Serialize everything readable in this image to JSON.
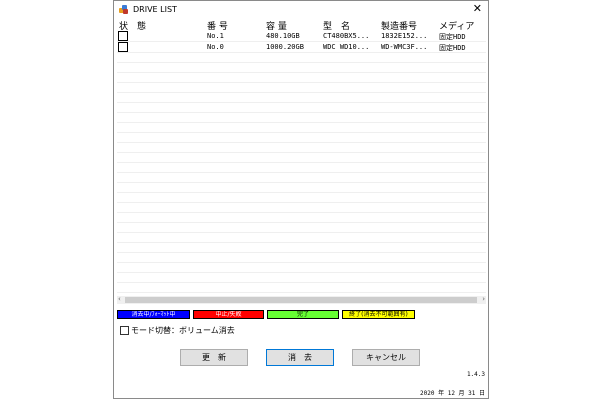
{
  "window": {
    "title": "DRIVE LIST",
    "close_glyph": "✕"
  },
  "columns": [
    "状　態",
    "番 号",
    "容 量",
    "型　名",
    "製造番号",
    "メディア"
  ],
  "rows": [
    {
      "checked": false,
      "number": "No.1",
      "capacity": "480.10GB",
      "model": "CT480BX5...",
      "serial": "1832E152...",
      "media": "固定HDD"
    },
    {
      "checked": false,
      "number": "No.0",
      "capacity": "1000.20GB",
      "model": "WDC WD10...",
      "serial": "WD-WMC3F...",
      "media": "固定HDD"
    }
  ],
  "legend": [
    {
      "label": "消去中/ﾌｫｰﾏｯﾄ中",
      "bg": "#0000ff",
      "fg": "#ffffff"
    },
    {
      "label": "中止/失敗",
      "bg": "#ff0000",
      "fg": "#ffffff"
    },
    {
      "label": "完了",
      "bg": "#66ff33",
      "fg": "#000000"
    },
    {
      "label": "終了(消去不可範囲有)",
      "bg": "#ffff00",
      "fg": "#000000"
    }
  ],
  "mode_switch": {
    "label": "モード切替：ボリューム消去",
    "checked": false
  },
  "buttons": {
    "refresh": "更　新",
    "erase": "消　去",
    "cancel": "キャンセル"
  },
  "version": "1.4.3",
  "date": "2020 年 12 月 31 日"
}
